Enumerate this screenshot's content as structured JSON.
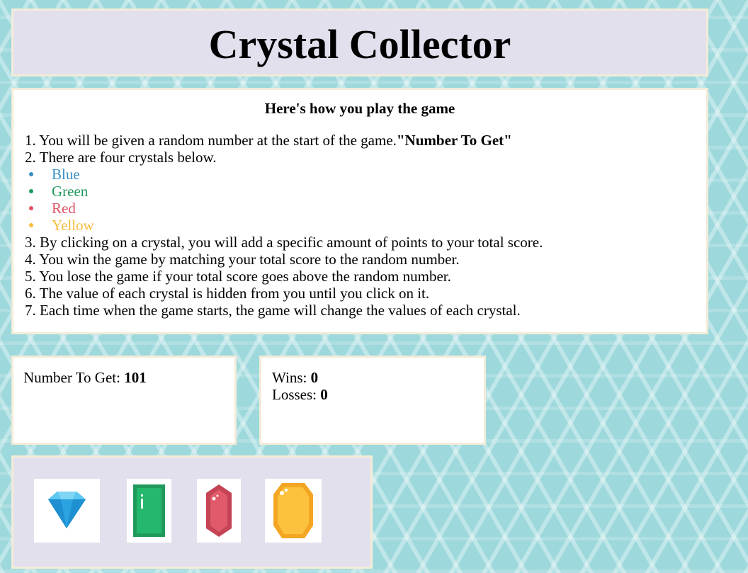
{
  "header": {
    "title": "Crystal Collector"
  },
  "instructions": {
    "heading": "Here's how you play the game",
    "step1_text": "1. You will be given a random number at the start of the game.",
    "step1_bold": "\"Number To Get\"",
    "step2": "2. There are four crystals below.",
    "colors": [
      {
        "label": "Blue",
        "color": "#3a8fc4"
      },
      {
        "label": "Green",
        "color": "#1f9a5a"
      },
      {
        "label": "Red",
        "color": "#de5466"
      },
      {
        "label": "Yellow",
        "color": "#f6bd3d"
      }
    ],
    "step3": "3. By clicking on a crystal, you will add a specific amount of points to your total score.",
    "step4": "4. You win the game by matching your total score to the random number.",
    "step5": "5. You lose the game if your total score goes above the random number.",
    "step6": "6. The value of each crystal is hidden from you until you click on it.",
    "step7": "7. Each time when the game starts, the game will change the values of each crystal."
  },
  "target": {
    "label": "Number To Get: ",
    "value": "101"
  },
  "score": {
    "wins_label": "Wins: ",
    "wins": "0",
    "losses_label": "Losses: ",
    "losses": "0"
  },
  "crystals": [
    {
      "icon": "blue-diamond-icon"
    },
    {
      "icon": "green-crystal-icon"
    },
    {
      "icon": "red-crystal-icon"
    },
    {
      "icon": "yellow-crystal-icon"
    }
  ]
}
